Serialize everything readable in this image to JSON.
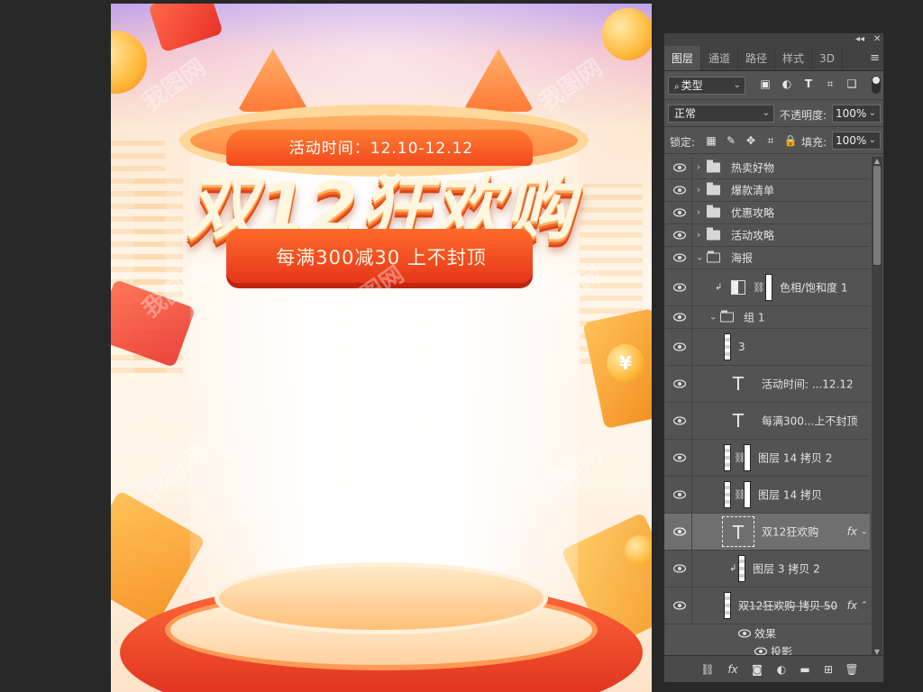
{
  "canvas": {
    "activity_time": "活动时间：12.10-12.12",
    "main_title": "双12狂欢购",
    "promo": "每满300减30 上不封顶",
    "watermark": "我图网",
    "coin_symbol": "¥"
  },
  "panel": {
    "collapse_glyph": "◂◂",
    "close_glyph": "✕",
    "menu_glyph": "≡",
    "tabs": [
      {
        "label": "图层",
        "active": true
      },
      {
        "label": "通道",
        "active": false
      },
      {
        "label": "路径",
        "active": false
      },
      {
        "label": "样式",
        "active": false
      },
      {
        "label": "3D",
        "active": false
      }
    ],
    "filter": {
      "label": "类型",
      "icon": "search-icon"
    },
    "blend_mode": "正常",
    "opacity_label": "不透明度:",
    "opacity_value": "100%",
    "lock_label": "锁定:",
    "fill_label": "填充:",
    "fill_value": "100%"
  },
  "layers": [
    {
      "name": "热卖好物",
      "kind": "group-closed"
    },
    {
      "name": "爆款清单",
      "kind": "group-closed"
    },
    {
      "name": "优惠攻略",
      "kind": "group-closed"
    },
    {
      "name": "活动攻略",
      "kind": "group-closed"
    },
    {
      "name": "海报",
      "kind": "group-open"
    },
    {
      "name": "色相/饱和度 1",
      "kind": "adjustment"
    },
    {
      "name": "组 1",
      "kind": "group-open"
    },
    {
      "name": "3",
      "kind": "pixel"
    },
    {
      "name": "活动时间:  ...12.12",
      "kind": "text"
    },
    {
      "name": "每满300...上不封顶",
      "kind": "text"
    },
    {
      "name": "图层 14 拷贝 2",
      "kind": "masked"
    },
    {
      "name": "图层 14 拷贝",
      "kind": "masked"
    },
    {
      "name": "双12狂欢购",
      "kind": "text",
      "fx": "fx",
      "selected": true
    },
    {
      "name": "图层 3 拷贝 2",
      "kind": "pixel"
    },
    {
      "name": "双12狂欢购 拷贝 50",
      "kind": "pixel",
      "fx": "fx"
    },
    {
      "name": "效果",
      "kind": "effects"
    },
    {
      "name": "投影",
      "kind": "effect-item"
    }
  ],
  "fx_label": "fx",
  "colors": {
    "panel_bg": "#535353",
    "selected_row": "#6f6f6f",
    "title_red": "#e6361a",
    "title_cream": "#fff6df"
  }
}
